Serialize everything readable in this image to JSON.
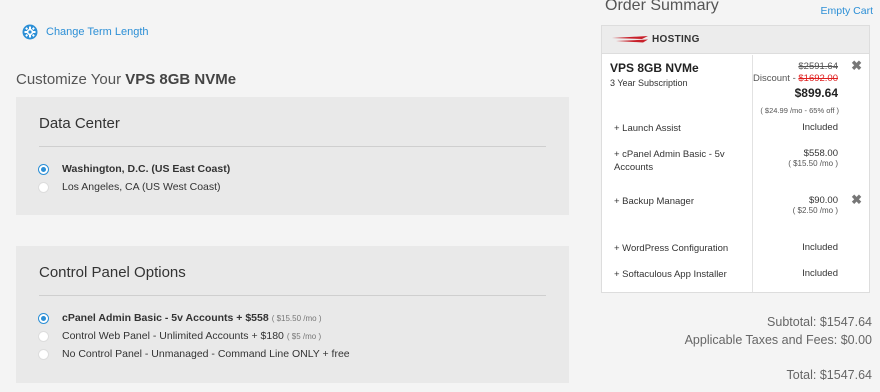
{
  "term": {
    "label": "Change Term Length",
    "icon": "gear-icon",
    "accent": "#2c8fd6"
  },
  "page": {
    "title_prefix": "Customize Your ",
    "title_product": "VPS 8GB NVMe"
  },
  "data_center": {
    "heading": "Data Center",
    "options": [
      {
        "label": "Washington, D.C. (US East Coast)",
        "selected": true
      },
      {
        "label": "Los Angeles, CA (US West Coast)",
        "selected": false
      }
    ]
  },
  "control_panel": {
    "heading": "Control Panel Options",
    "options": [
      {
        "label": "cPanel Admin Basic - 5v Accounts + $558",
        "note": "( $15.50 /mo )",
        "selected": true
      },
      {
        "label": "Control Web Panel - Unlimited Accounts + $180",
        "note": "( $5 /mo )",
        "selected": false
      },
      {
        "label": "No Control Panel - Unmanaged - Command Line ONLY + free",
        "note": "",
        "selected": false
      }
    ]
  },
  "order": {
    "title": "Order Summary",
    "empty_cart": "Empty Cart",
    "category": "HOSTING",
    "product": {
      "name": "VPS 8GB NVMe",
      "subscription": "3 Year Subscription",
      "original_price": "$2591.64",
      "discount_label": "Discount - ",
      "discount_value": "$1692.00",
      "price": "$899.64",
      "per_month": "( $24.99 /mo - 65% off )"
    },
    "lines": [
      {
        "label": "+ Launch Assist",
        "value": "Included",
        "sub": ""
      },
      {
        "label": "+ cPanel Admin Basic - 5v Accounts",
        "value": "$558.00",
        "sub": "( $15.50 /mo )"
      },
      {
        "label": "+ Backup Manager",
        "value": "$90.00",
        "sub": "( $2.50 /mo )"
      },
      {
        "label": "+ WordPress Configuration",
        "value": "Included",
        "sub": ""
      },
      {
        "label": "+ Softaculous App Installer",
        "value": "Included",
        "sub": ""
      }
    ],
    "remove_glyph": "✖",
    "subtotal": "Subtotal: $1547.64",
    "taxes": "Applicable Taxes and Fees: $0.00",
    "total": "Total: $1547.64"
  }
}
